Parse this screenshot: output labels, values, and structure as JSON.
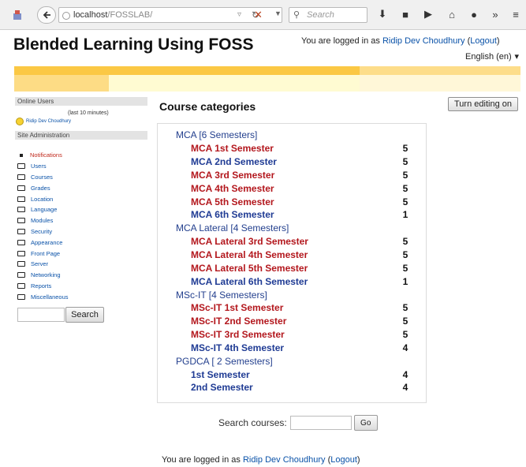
{
  "browser": {
    "url_host": "localhost",
    "url_path": "/FOSSLAB/",
    "search_placeholder": "Search"
  },
  "header": {
    "site_title": "Blended Learning Using FOSS",
    "login_prefix": "You are logged in as ",
    "user_name": "Ridip Dev Choudhury",
    "logout_label": "Logout",
    "language": "English (en)"
  },
  "sidebar": {
    "online_users_title": "Online Users",
    "online_users_sub": "(last 10 minutes)",
    "online_user": "Ridip Dev Choudhury",
    "admin_title": "Site Administration",
    "admin_items": [
      {
        "label": "Notifications",
        "kind": "bullet"
      },
      {
        "label": "Users",
        "kind": "folder"
      },
      {
        "label": "Courses",
        "kind": "folder"
      },
      {
        "label": "Grades",
        "kind": "folder"
      },
      {
        "label": "Location",
        "kind": "folder"
      },
      {
        "label": "Language",
        "kind": "folder"
      },
      {
        "label": "Modules",
        "kind": "folder"
      },
      {
        "label": "Security",
        "kind": "folder"
      },
      {
        "label": "Appearance",
        "kind": "folder"
      },
      {
        "label": "Front Page",
        "kind": "folder"
      },
      {
        "label": "Server",
        "kind": "folder"
      },
      {
        "label": "Networking",
        "kind": "folder"
      },
      {
        "label": "Reports",
        "kind": "folder"
      },
      {
        "label": "Miscellaneous",
        "kind": "folder"
      }
    ],
    "search_button": "Search"
  },
  "main": {
    "title": "Course categories",
    "edit_button": "Turn editing on",
    "categories": [
      {
        "name": "MCA [6 Semesters]",
        "level": "top",
        "count": ""
      },
      {
        "name": "MCA 1st Semester",
        "level": "sub",
        "color": "red",
        "count": "5"
      },
      {
        "name": "MCA 2nd Semester",
        "level": "sub",
        "color": "blue",
        "count": "5"
      },
      {
        "name": "MCA 3rd Semester",
        "level": "sub",
        "color": "red",
        "count": "5"
      },
      {
        "name": "MCA 4th Semester",
        "level": "sub",
        "color": "red",
        "count": "5"
      },
      {
        "name": "MCA 5th Semester",
        "level": "sub",
        "color": "red",
        "count": "5"
      },
      {
        "name": "MCA 6th Semester",
        "level": "sub",
        "color": "blue",
        "count": "1"
      },
      {
        "name": "MCA Lateral [4 Semesters]",
        "level": "top",
        "count": ""
      },
      {
        "name": "MCA Lateral 3rd Semester",
        "level": "sub",
        "color": "red",
        "count": "5"
      },
      {
        "name": "MCA Lateral 4th Semester",
        "level": "sub",
        "color": "red",
        "count": "5"
      },
      {
        "name": "MCA Lateral 5th Semester",
        "level": "sub",
        "color": "red",
        "count": "5"
      },
      {
        "name": "MCA Lateral 6th Semester",
        "level": "sub",
        "color": "blue",
        "count": "1"
      },
      {
        "name": "MSc-IT [4 Semesters]",
        "level": "top",
        "count": ""
      },
      {
        "name": "MSc-IT 1st Semester",
        "level": "sub",
        "color": "red",
        "count": "5"
      },
      {
        "name": "MSc-IT 2nd Semester",
        "level": "sub",
        "color": "red",
        "count": "5"
      },
      {
        "name": "MSc-IT 3rd Semester",
        "level": "sub",
        "color": "red",
        "count": "5"
      },
      {
        "name": "MSc-IT 4th Semester",
        "level": "sub",
        "color": "blue",
        "count": "4"
      },
      {
        "name": "PGDCA [ 2 Semesters]",
        "level": "top",
        "count": ""
      },
      {
        "name": "1st Semester",
        "level": "sub",
        "color": "blue",
        "count": "4"
      },
      {
        "name": "2nd Semester",
        "level": "sub",
        "color": "blue",
        "count": "4"
      }
    ],
    "search_label": "Search courses:",
    "go_button": "Go"
  },
  "footer": {
    "login_prefix": "You are logged in as ",
    "user_name": "Ridip Dev Choudhury",
    "logout_label": "Logout"
  },
  "colors": {
    "link_blue": "#1f3b94",
    "link_red": "#b3171d",
    "banner_orange": "#fbc844"
  }
}
